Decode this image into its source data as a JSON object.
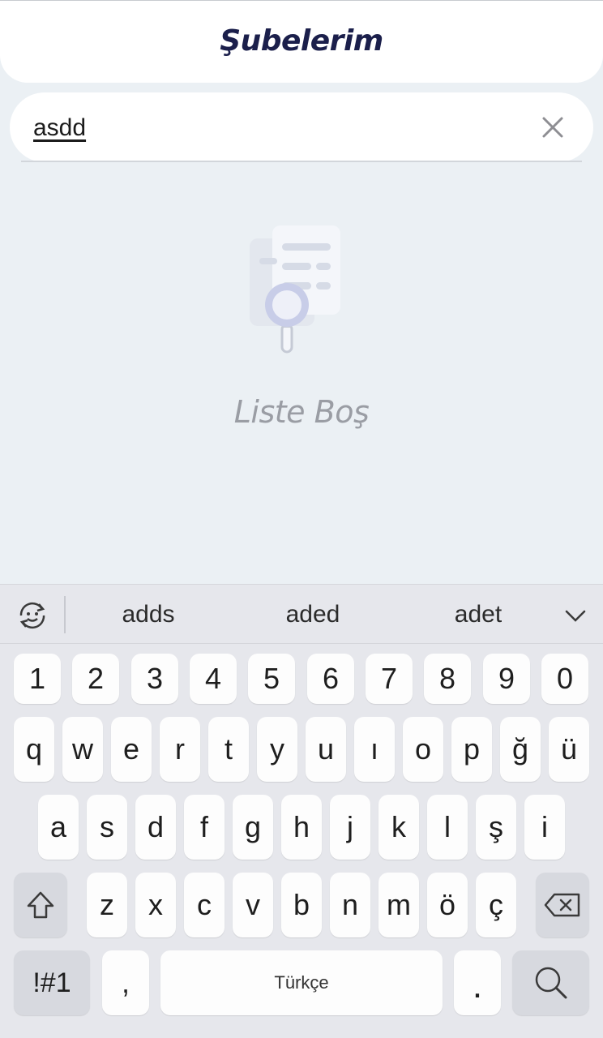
{
  "header": {
    "title": "Şubelerim"
  },
  "search": {
    "value": "asdd"
  },
  "empty_state": {
    "text": "Liste Boş"
  },
  "keyboard": {
    "suggestions": [
      "adds",
      "aded",
      "adet"
    ],
    "number_row": [
      "1",
      "2",
      "3",
      "4",
      "5",
      "6",
      "7",
      "8",
      "9",
      "0"
    ],
    "row1": [
      "q",
      "w",
      "e",
      "r",
      "t",
      "y",
      "u",
      "ı",
      "o",
      "p",
      "ğ",
      "ü"
    ],
    "row2": [
      "a",
      "s",
      "d",
      "f",
      "g",
      "h",
      "j",
      "k",
      "l",
      "ş",
      "i"
    ],
    "row3": [
      "z",
      "x",
      "c",
      "v",
      "b",
      "n",
      "m",
      "ö",
      "ç"
    ],
    "symbols_label": "!#1",
    "comma_label": ",",
    "space_label": "Türkçe",
    "period_label": "."
  },
  "colors": {
    "background": "#ebf0f4",
    "header_title": "#1b1f4b",
    "empty_text": "#9a9da4",
    "keyboard_bg": "#e6e7ec"
  }
}
